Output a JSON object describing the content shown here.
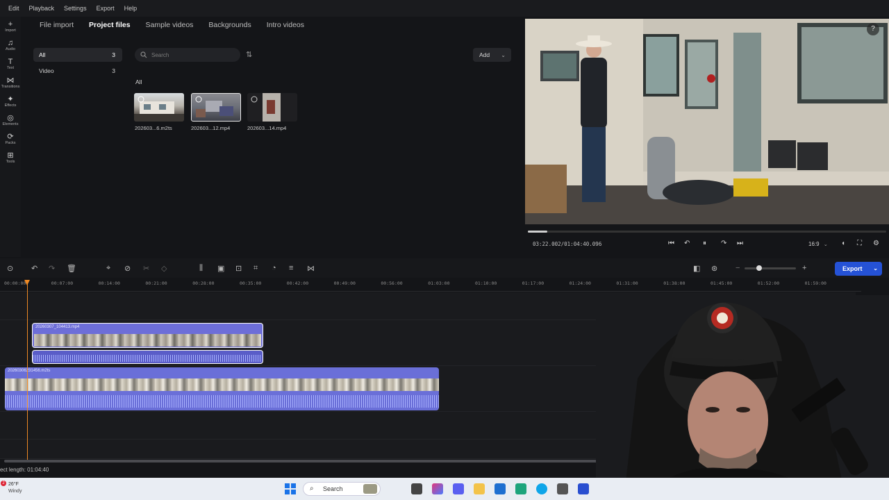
{
  "menu": [
    "Edit",
    "Playback",
    "Settings",
    "Export",
    "Help"
  ],
  "rail": [
    {
      "icon": "plus-icon",
      "glyph": "+",
      "label": "Import"
    },
    {
      "icon": "music-note-icon",
      "glyph": "♫",
      "label": "Audio"
    },
    {
      "icon": "text-icon",
      "glyph": "T",
      "label": "Text"
    },
    {
      "icon": "transitions-icon",
      "glyph": "⋈",
      "label": "Transitions"
    },
    {
      "icon": "effects-icon",
      "glyph": "✦",
      "label": "Effects"
    },
    {
      "icon": "elements-icon",
      "glyph": "◎",
      "label": "Elements"
    },
    {
      "icon": "packs-icon",
      "glyph": "⟳",
      "label": "Packs"
    },
    {
      "icon": "tools-icon",
      "glyph": "⊞",
      "label": "Tools"
    }
  ],
  "media_tabs": [
    {
      "label": "File import",
      "active": false
    },
    {
      "label": "Project files",
      "active": true
    },
    {
      "label": "Sample videos",
      "active": false
    },
    {
      "label": "Backgrounds",
      "active": false
    },
    {
      "label": "Intro videos",
      "active": false
    }
  ],
  "categories": [
    {
      "label": "All",
      "count": "3",
      "selected": true
    },
    {
      "label": "Video",
      "count": "3",
      "selected": false
    }
  ],
  "search": {
    "placeholder": "Search"
  },
  "add_button": "Add",
  "media_section_label": "All",
  "media_items": [
    {
      "name": "202603...6.m2ts"
    },
    {
      "name": "202603...12.mp4"
    },
    {
      "name": "202603...14.mp4"
    }
  ],
  "preview": {
    "timecode": "03:22.002/01:04:40.096",
    "aspect_ratio": "16:9",
    "progress": 0.05
  },
  "timeline": {
    "ruler_ticks": [
      "00:00:00",
      "00:07:00",
      "00:14:00",
      "00:21:00",
      "00:28:00",
      "00:35:00",
      "00:42:00",
      "00:49:00",
      "00:56:00",
      "01:03:00",
      "01:10:00",
      "01:17:00",
      "01:24:00",
      "01:31:00",
      "01:38:00",
      "01:45:00",
      "01:52:00",
      "01:59:00"
    ],
    "clips": [
      {
        "title": "20260307_104413.mp4"
      },
      {
        "title": "20260306231456.m2ts"
      }
    ],
    "export_label": "Export",
    "project_length": "ect length: 01:04:40"
  },
  "taskbar": {
    "temperature": "26°F",
    "weather": "Windy",
    "badge": "2",
    "search_placeholder": "Search"
  },
  "colors": {
    "accent": "#2552d6",
    "playhead": "#f08a24",
    "clip": "#6a6fd8"
  }
}
